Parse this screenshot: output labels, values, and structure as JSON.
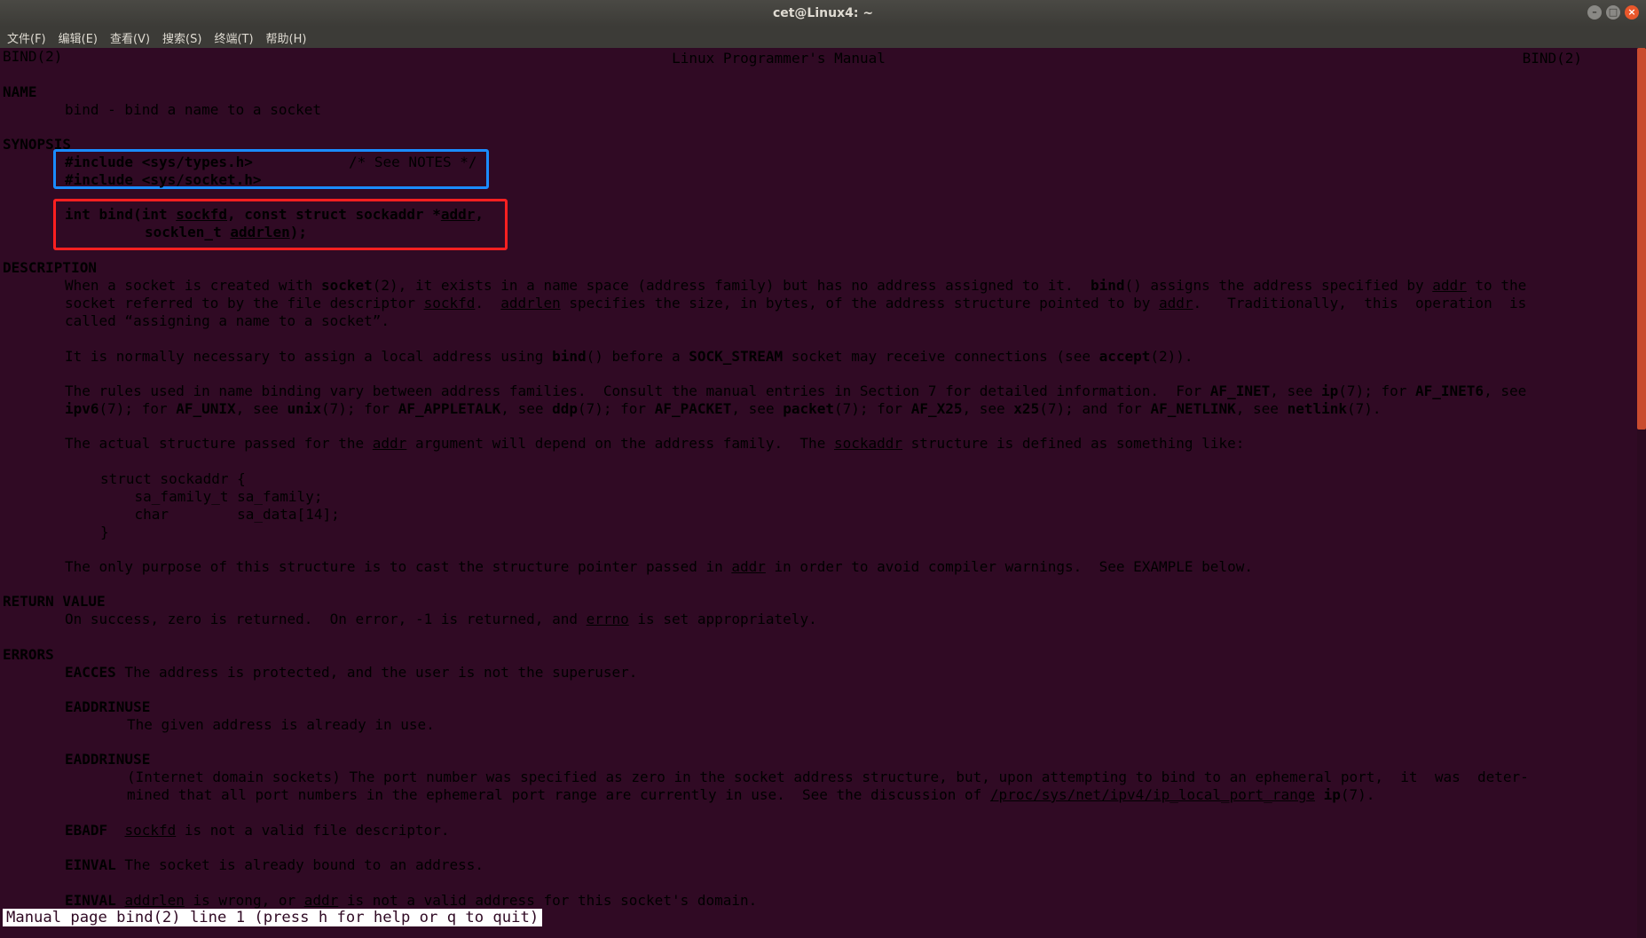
{
  "window": {
    "title": "cet@Linux4: ~"
  },
  "menu": [
    "文件(F)",
    "编辑(E)",
    "查看(V)",
    "搜索(S)",
    "终端(T)",
    "帮助(H)"
  ],
  "header": {
    "left": "BIND(2)",
    "center": "Linux Programmer's Manual",
    "right": "BIND(2)"
  },
  "name": {
    "heading": "NAME",
    "text": "bind - bind a name to a socket"
  },
  "synopsis": {
    "heading": "SYNOPSIS",
    "include1": "#include <sys/types.h>",
    "include1_comment": "/* See NOTES */",
    "include2": "#include <sys/socket.h>",
    "sig1a": "int bind(int ",
    "sig1b": "sockfd",
    "sig1c": ", const struct sockaddr *",
    "sig1d": "addr",
    "sig1e": ",",
    "sig2a": "socklen_t ",
    "sig2b": "addrlen",
    "sig2c": ");"
  },
  "description": {
    "heading": "DESCRIPTION",
    "p1l1": [
      "When a socket is created with ",
      "socket",
      "(2), it exists in a name space (address family) but has no address assigned to it.  ",
      "bind",
      "() assigns the address specified by ",
      "addr",
      " to the"
    ],
    "p1l2": [
      "socket referred to by the file descriptor ",
      "sockfd",
      ".  ",
      "addrlen",
      " specifies the size, in bytes, of the address structure pointed to by ",
      "addr",
      ".   Traditionally,  this  operation  is"
    ],
    "p1l3": "called “assigning a name to a socket”.",
    "p2": [
      "It is normally necessary to assign a local address using ",
      "bind",
      "() before a ",
      "SOCK_STREAM",
      " socket may receive connections (see ",
      "accept",
      "(2))."
    ],
    "p3l1": [
      "The rules used in name binding vary between address families.  Consult the manual entries in Section 7 for detailed information.  For ",
      "AF_INET",
      ", see ",
      "ip",
      "(7); for ",
      "AF_INET6",
      ", see"
    ],
    "p3l2": [
      "ipv6",
      "(7); for ",
      "AF_UNIX",
      ", see ",
      "unix",
      "(7); for ",
      "AF_APPLETALK",
      ", see ",
      "ddp",
      "(7); for ",
      "AF_PACKET",
      ", see ",
      "packet",
      "(7); for ",
      "AF_X25",
      ", see ",
      "x25",
      "(7); and for ",
      "AF_NETLINK",
      ", see ",
      "netlink",
      "(7)."
    ],
    "p4": [
      "The actual structure passed for the ",
      "addr",
      " argument will depend on the address family.  The ",
      "sockaddr",
      " structure is defined as something like:"
    ],
    "code1": "struct sockaddr {",
    "code2": "    sa_family_t sa_family;",
    "code3": "    char        sa_data[14];",
    "code4": "}",
    "p5": [
      "The only purpose of this structure is to cast the structure pointer passed in ",
      "addr",
      " in order to avoid compiler warnings.  See EXAMPLE below."
    ]
  },
  "return_value": {
    "heading": "RETURN VALUE",
    "text": [
      "On success, zero is returned.  On error, -1 is returned, and ",
      "errno",
      " is set appropriately."
    ]
  },
  "errors": {
    "heading": "ERRORS",
    "eacces_name": "EACCES",
    "eacces_text": " The address is protected, and the user is not the superuser.",
    "eaddrinuse1_name": "EADDRINUSE",
    "eaddrinuse1_text": "The given address is already in use.",
    "eaddrinuse2_name": "EADDRINUSE",
    "eaddrinuse2_l1": "(Internet domain sockets) The port number was specified as zero in the socket address structure, but, upon attempting to bind to an ephemeral port,  it  was  deter‐",
    "eaddrinuse2_l2": [
      "mined that all port numbers in the ephemeral port range are currently in use.  See the discussion of ",
      "/proc/sys/net/ipv4/ip_local_port_range",
      " ",
      "ip",
      "(7)."
    ],
    "ebadf_name": "EBADF",
    "ebadf_text": [
      "  ",
      "sockfd",
      " is not a valid file descriptor."
    ],
    "einval1_name": "EINVAL",
    "einval1_text": " The socket is already bound to an address.",
    "einval2_name": "EINVAL",
    "einval2_text": [
      " ",
      "addrlen",
      " is wrong, or ",
      "addr",
      " is not a valid address for this socket's domain."
    ]
  },
  "status_line": "Manual page bind(2) line 1 (press h for help or q to quit)",
  "colors": {
    "background": "#300a24",
    "highlight_blue": "#1a8cff",
    "highlight_red": "#ff2020"
  }
}
